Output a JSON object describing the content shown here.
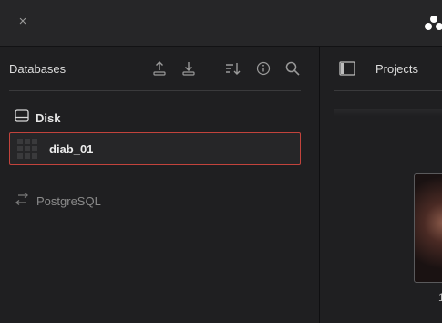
{
  "window": {
    "close_glyph": "×",
    "logo_icon": "davinci-resolve-logo"
  },
  "databases_panel": {
    "title": "Databases",
    "toolbar": [
      "upload-icon",
      "download-icon",
      "sort-icon",
      "info-icon",
      "search-icon"
    ],
    "disk_section": {
      "label": "Disk",
      "icon": "disk-drive-icon",
      "items": [
        {
          "name": "diab_01",
          "selected": true
        }
      ]
    },
    "network_section": {
      "label": "PostgreSQL",
      "icon": "connect-arrows-icon"
    },
    "accent_color": "#c2433c"
  },
  "projects_panel": {
    "title": "Projects",
    "toggle_icon": "panel-toggle-icon",
    "project_label_fragment": "1"
  }
}
